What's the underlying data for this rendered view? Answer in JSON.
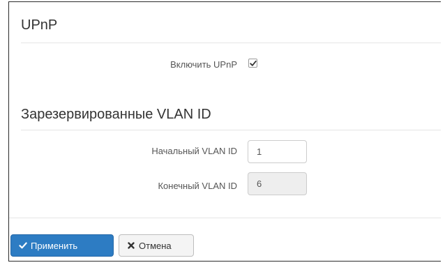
{
  "upnp": {
    "title": "UPnP",
    "enable_label": "Включить UPnP",
    "enabled": true
  },
  "vlan": {
    "title": "Зарезервированные VLAN ID",
    "start_label": "Начальный VLAN ID",
    "start_value": "1",
    "end_label": "Конечный VLAN ID",
    "end_value": "6"
  },
  "actions": {
    "apply_label": "Применить",
    "apply_icon": "check-icon",
    "cancel_label": "Отмена",
    "cancel_icon": "close-icon"
  },
  "colors": {
    "primary": "#2d7cc3",
    "text": "#333333",
    "divider": "#e5e5e5"
  }
}
